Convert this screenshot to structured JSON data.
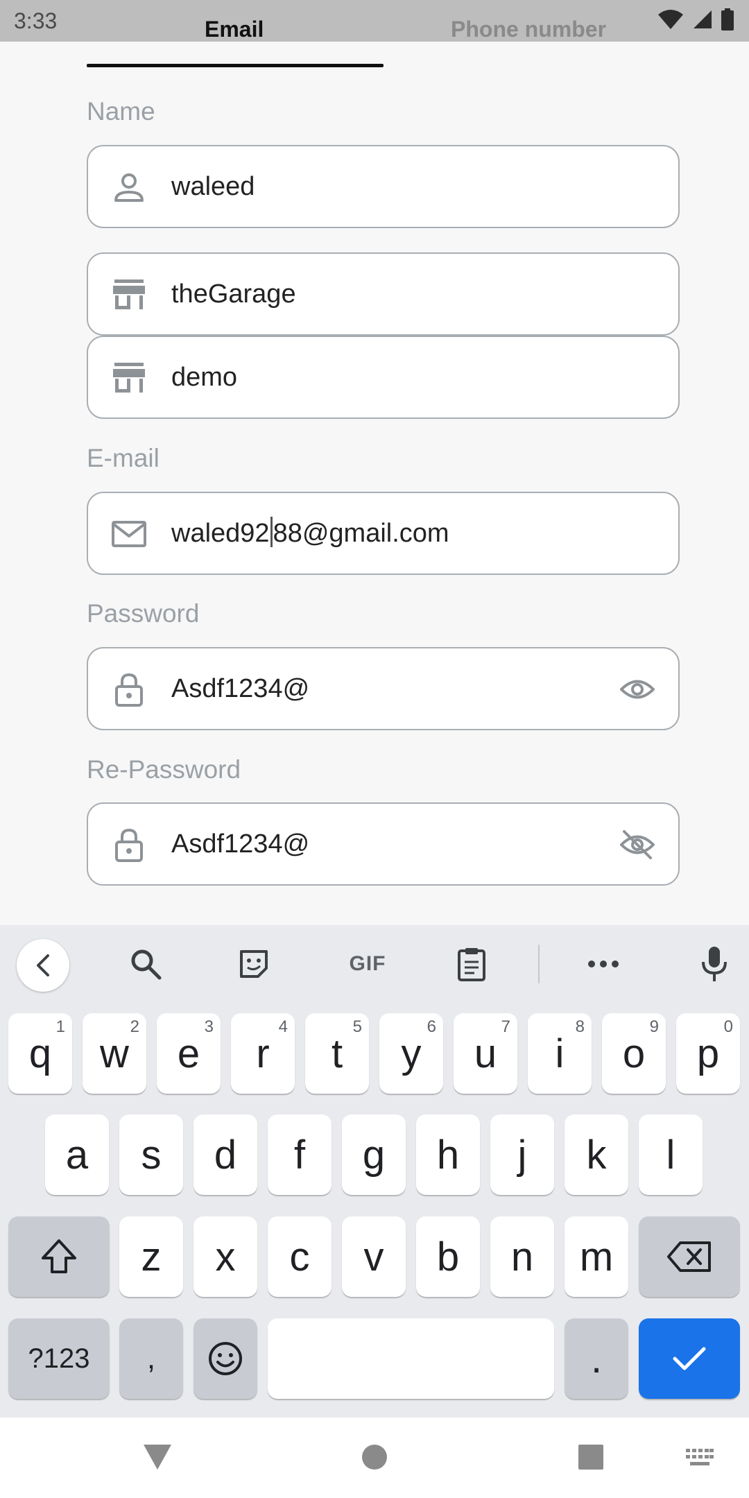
{
  "status": {
    "time": "3:33"
  },
  "tabs": {
    "email": "Email",
    "phone": "Phone number"
  },
  "form": {
    "name_label": "Name",
    "name_value": "waleed",
    "store1_value": "theGarage",
    "store2_value": "demo",
    "email_label": "E-mail",
    "email_value_before": "waled92",
    "email_value_after": "88@gmail.com",
    "password_label": "Password",
    "password_value": "Asdf1234@",
    "repassword_label": "Re-Password",
    "repassword_value": "Asdf1234@"
  },
  "keyboard": {
    "toolbar": {
      "gif": "GIF"
    },
    "row1": [
      {
        "k": "q",
        "h": "1"
      },
      {
        "k": "w",
        "h": "2"
      },
      {
        "k": "e",
        "h": "3"
      },
      {
        "k": "r",
        "h": "4"
      },
      {
        "k": "t",
        "h": "5"
      },
      {
        "k": "y",
        "h": "6"
      },
      {
        "k": "u",
        "h": "7"
      },
      {
        "k": "i",
        "h": "8"
      },
      {
        "k": "o",
        "h": "9"
      },
      {
        "k": "p",
        "h": "0"
      }
    ],
    "row2": [
      "a",
      "s",
      "d",
      "f",
      "g",
      "h",
      "j",
      "k",
      "l"
    ],
    "row3": [
      "z",
      "x",
      "c",
      "v",
      "b",
      "n",
      "m"
    ],
    "symbols": "?123",
    "comma": ",",
    "period": "."
  },
  "colors": {
    "accent": "#1a73e8",
    "icon": "#8d9296"
  }
}
